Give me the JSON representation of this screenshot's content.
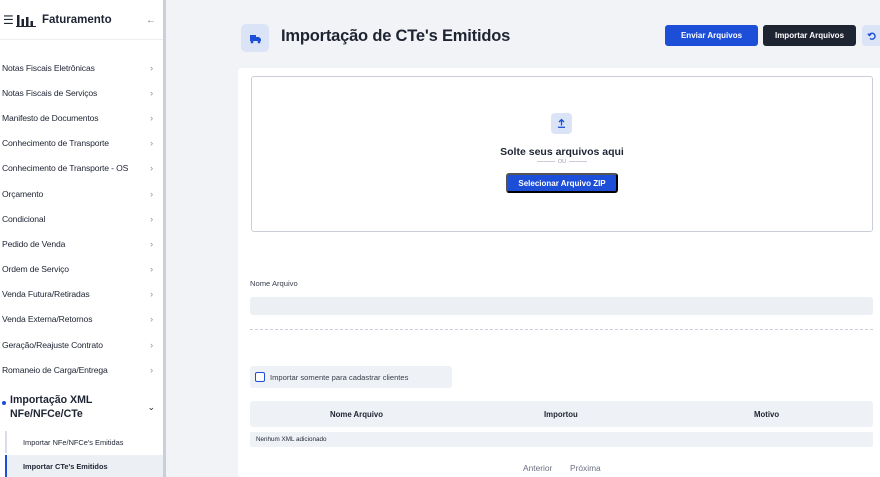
{
  "sidebar": {
    "title": "Faturamento",
    "items": [
      {
        "label": "Notas Fiscais Eletrônicas"
      },
      {
        "label": "Notas Fiscais de Serviços"
      },
      {
        "label": "Manifesto de Documentos"
      },
      {
        "label": "Conhecimento de Transporte"
      },
      {
        "label": "Conhecimento de Transporte - OS"
      },
      {
        "label": "Orçamento"
      },
      {
        "label": "Condicional"
      },
      {
        "label": "Pedido de Venda"
      },
      {
        "label": "Ordem de Serviço"
      },
      {
        "label": "Venda Futura/Retiradas"
      },
      {
        "label": "Venda Externa/Retornos"
      },
      {
        "label": "Geração/Reajuste Contrato"
      },
      {
        "label": "Romaneio de Carga/Entrega"
      }
    ],
    "active_group": {
      "label": "Importação XML NFe/NFCe/CTe",
      "children": [
        {
          "label": "Importar NFe/NFCe's Emitidas"
        },
        {
          "label": "Importar CTe's Emitidos"
        }
      ]
    }
  },
  "header": {
    "title": "Importação de CTe's Emitidos",
    "send_label": "Enviar Arquivos",
    "import_label": "Importar Arquivos"
  },
  "dropzone": {
    "title": "Solte seus arquivos aqui",
    "or": "OU",
    "button_label": "Selecionar Arquivo ZIP"
  },
  "form": {
    "file_name_label": "Nome Arquivo",
    "file_name_value": "",
    "checkbox_label": "Importar somente para cadastrar clientes"
  },
  "table": {
    "columns": [
      "Nome Arquivo",
      "Importou",
      "Motivo"
    ],
    "empty_text": "Nenhum XML adicionado"
  },
  "pager": {
    "prev": "Anterior",
    "next": "Próxima"
  },
  "colors": {
    "accent": "#1d4ed8",
    "dark": "#1f2433",
    "background": "#f1f3f6"
  }
}
